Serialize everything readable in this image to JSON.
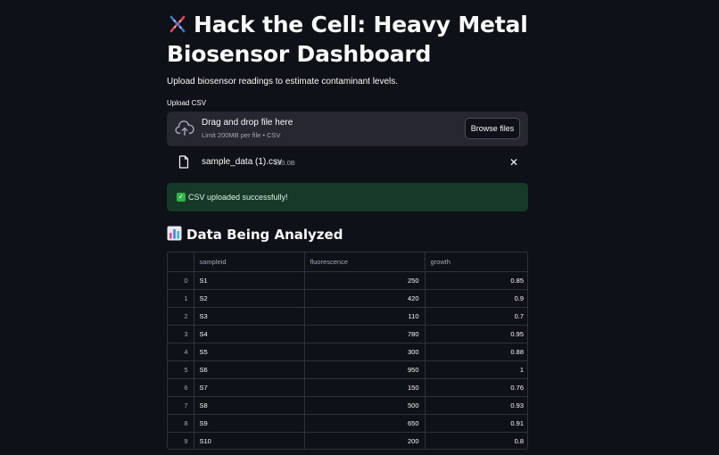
{
  "header": {
    "emoji": "dna-emoji",
    "title_line1": "Hack the Cell: Heavy Metal",
    "title_line2": "Biosensor Dashboard",
    "subtitle": "Upload biosensor readings to estimate contaminant levels."
  },
  "uploader": {
    "label": "Upload CSV",
    "drop_text": "Drag and drop file here",
    "limit_text": "Limit 200MB per file • CSV",
    "browse_label": "Browse files",
    "file_name": "sample_data (1).csv",
    "file_size": "150.0B",
    "remove_symbol": "✕"
  },
  "alert": {
    "check_symbol": "✓",
    "message": "CSV uploaded successfully!"
  },
  "section": {
    "emoji": "bar-chart-emoji",
    "title": "Data Being Analyzed"
  },
  "table": {
    "columns": [
      "",
      "sampleid",
      "fluorescence",
      "growth"
    ],
    "rows": [
      {
        "index": "0",
        "sampleid": "S1",
        "fluorescence": "250",
        "growth": "0.85"
      },
      {
        "index": "1",
        "sampleid": "S2",
        "fluorescence": "420",
        "growth": "0.9"
      },
      {
        "index": "2",
        "sampleid": "S3",
        "fluorescence": "110",
        "growth": "0.7"
      },
      {
        "index": "3",
        "sampleid": "S4",
        "fluorescence": "780",
        "growth": "0.95"
      },
      {
        "index": "4",
        "sampleid": "S5",
        "fluorescence": "300",
        "growth": "0.88"
      },
      {
        "index": "5",
        "sampleid": "S6",
        "fluorescence": "950",
        "growth": "1"
      },
      {
        "index": "6",
        "sampleid": "S7",
        "fluorescence": "150",
        "growth": "0.76"
      },
      {
        "index": "7",
        "sampleid": "S8",
        "fluorescence": "500",
        "growth": "0.93"
      },
      {
        "index": "8",
        "sampleid": "S9",
        "fluorescence": "650",
        "growth": "0.91"
      },
      {
        "index": "9",
        "sampleid": "S10",
        "fluorescence": "200",
        "growth": "0.8"
      }
    ]
  },
  "colors": {
    "background": "#0e1117",
    "dropzone": "#262730",
    "success_bg": "#173928",
    "success_check": "#2fb34a"
  }
}
